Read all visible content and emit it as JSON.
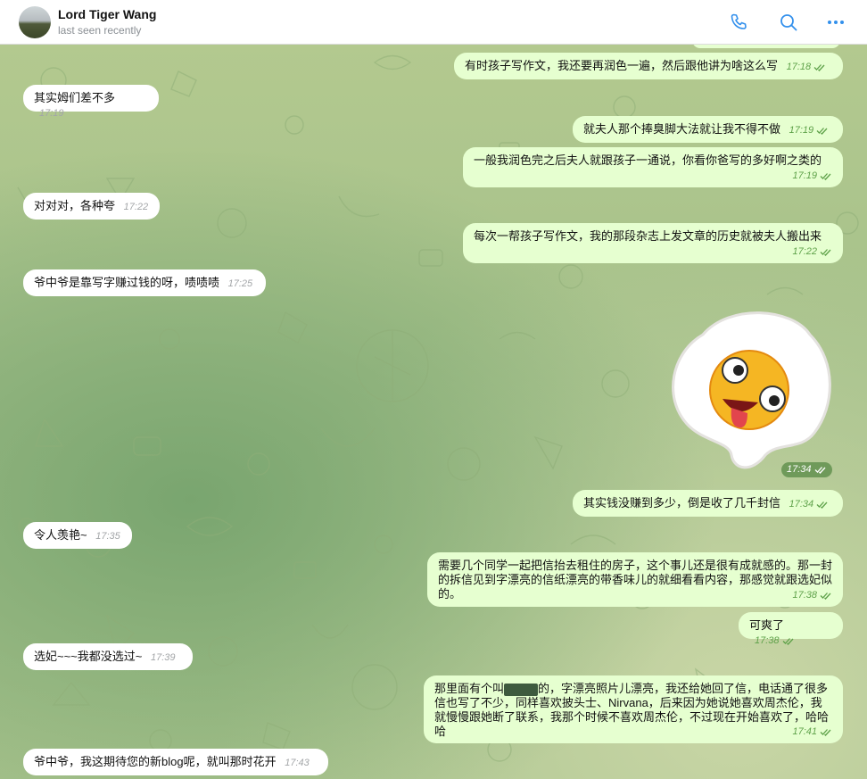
{
  "header": {
    "name": "Lord Tiger Wang",
    "status": "last seen recently"
  },
  "messages": [
    {
      "dir": "out",
      "text": "有时孩子写作文，我还要再润色一遍，然后跟他讲为啥这么写",
      "time": "17:18"
    },
    {
      "dir": "in",
      "text": "其实姆们差不多",
      "time": "17:19"
    },
    {
      "dir": "out",
      "text": "就夫人那个捧臭脚大法就让我不得不做",
      "time": "17:19"
    },
    {
      "dir": "out",
      "text": "一般我润色完之后夫人就跟孩子一通说，你看你爸写的多好啊之类的",
      "time": "17:19"
    },
    {
      "dir": "in",
      "text": "对对对，各种夸",
      "time": "17:22"
    },
    {
      "dir": "out",
      "text": "每次一帮孩子写作文，我的那段杂志上发文章的历史就被夫人搬出来",
      "time": "17:22"
    },
    {
      "dir": "in",
      "text": "爷中爷是靠写字赚过钱的呀，啧啧啧",
      "time": "17:25"
    },
    {
      "dir": "sticker",
      "text": "",
      "time": "17:34"
    },
    {
      "dir": "out",
      "text": "其实钱没赚到多少，倒是收了几千封信",
      "time": "17:34"
    },
    {
      "dir": "in",
      "text": "令人羡艳~",
      "time": "17:35"
    },
    {
      "dir": "out",
      "text": "需要几个同学一起把信抬去租住的房子，这个事儿还是很有成就感的。那一封的拆信见到字漂亮的信纸漂亮的带香味儿的就细看看内容，那感觉就跟选妃似的。",
      "time": "17:38"
    },
    {
      "dir": "out",
      "text": "可爽了",
      "time": "17:38"
    },
    {
      "dir": "in",
      "text": "选妃~~~我都没选过~",
      "time": "17:39"
    },
    {
      "dir": "out",
      "text_before": "那里面有个叫",
      "text_after": "的，字漂亮照片儿漂亮，我还给她回了信，电话通了很多信也写了不少，同样喜欢披头士、Nirvana，后来因为她说她喜欢周杰伦，我就慢慢跟她断了联系，我那个时候不喜欢周杰伦，不过现在开始喜欢了，哈哈哈",
      "time": "17:41"
    },
    {
      "dir": "in",
      "text": "爷中爷，我这期待您的新blog呢，就叫那时花开",
      "time": "17:43"
    }
  ],
  "icons": {
    "call": "phone-icon",
    "search": "search-icon",
    "more": "more-icon",
    "read": "double-check-icon"
  },
  "colors": {
    "incoming": "#ffffff",
    "outgoing": "#e6ffd0",
    "accent": "#3390ec",
    "time_out": "#5fa24a"
  }
}
